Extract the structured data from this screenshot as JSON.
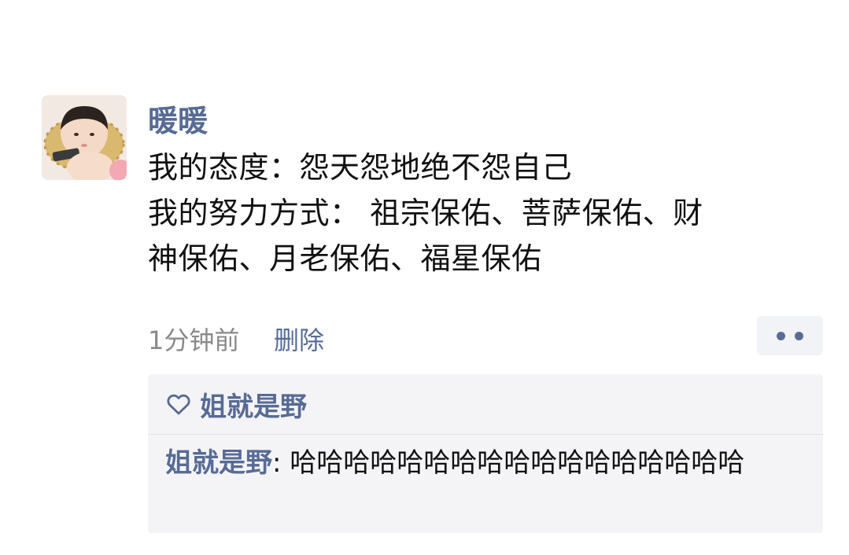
{
  "post": {
    "author": "暖暖",
    "lines": [
      "我的态度：怨天怨地绝不怨自己",
      "我的努力方式： 祖宗保佑、菩萨保佑、财",
      "神保佑、月老保佑、福星保佑"
    ],
    "timestamp": "1分钟前",
    "delete_label": "删除"
  },
  "likes": {
    "names": "姐就是野"
  },
  "comments": [
    {
      "author": "姐就是野",
      "separator": ": ",
      "text": "哈哈哈哈哈哈哈哈哈哈哈哈哈哈哈哈哈"
    }
  ],
  "icons": {
    "avatar": "baby-photo-avatar",
    "like": "heart-outline-icon",
    "more": "more-dots-icon"
  },
  "colors": {
    "link": "#576b95",
    "text": "#111111",
    "meta": "#8a8a8a",
    "panel": "#f4f4f6"
  }
}
